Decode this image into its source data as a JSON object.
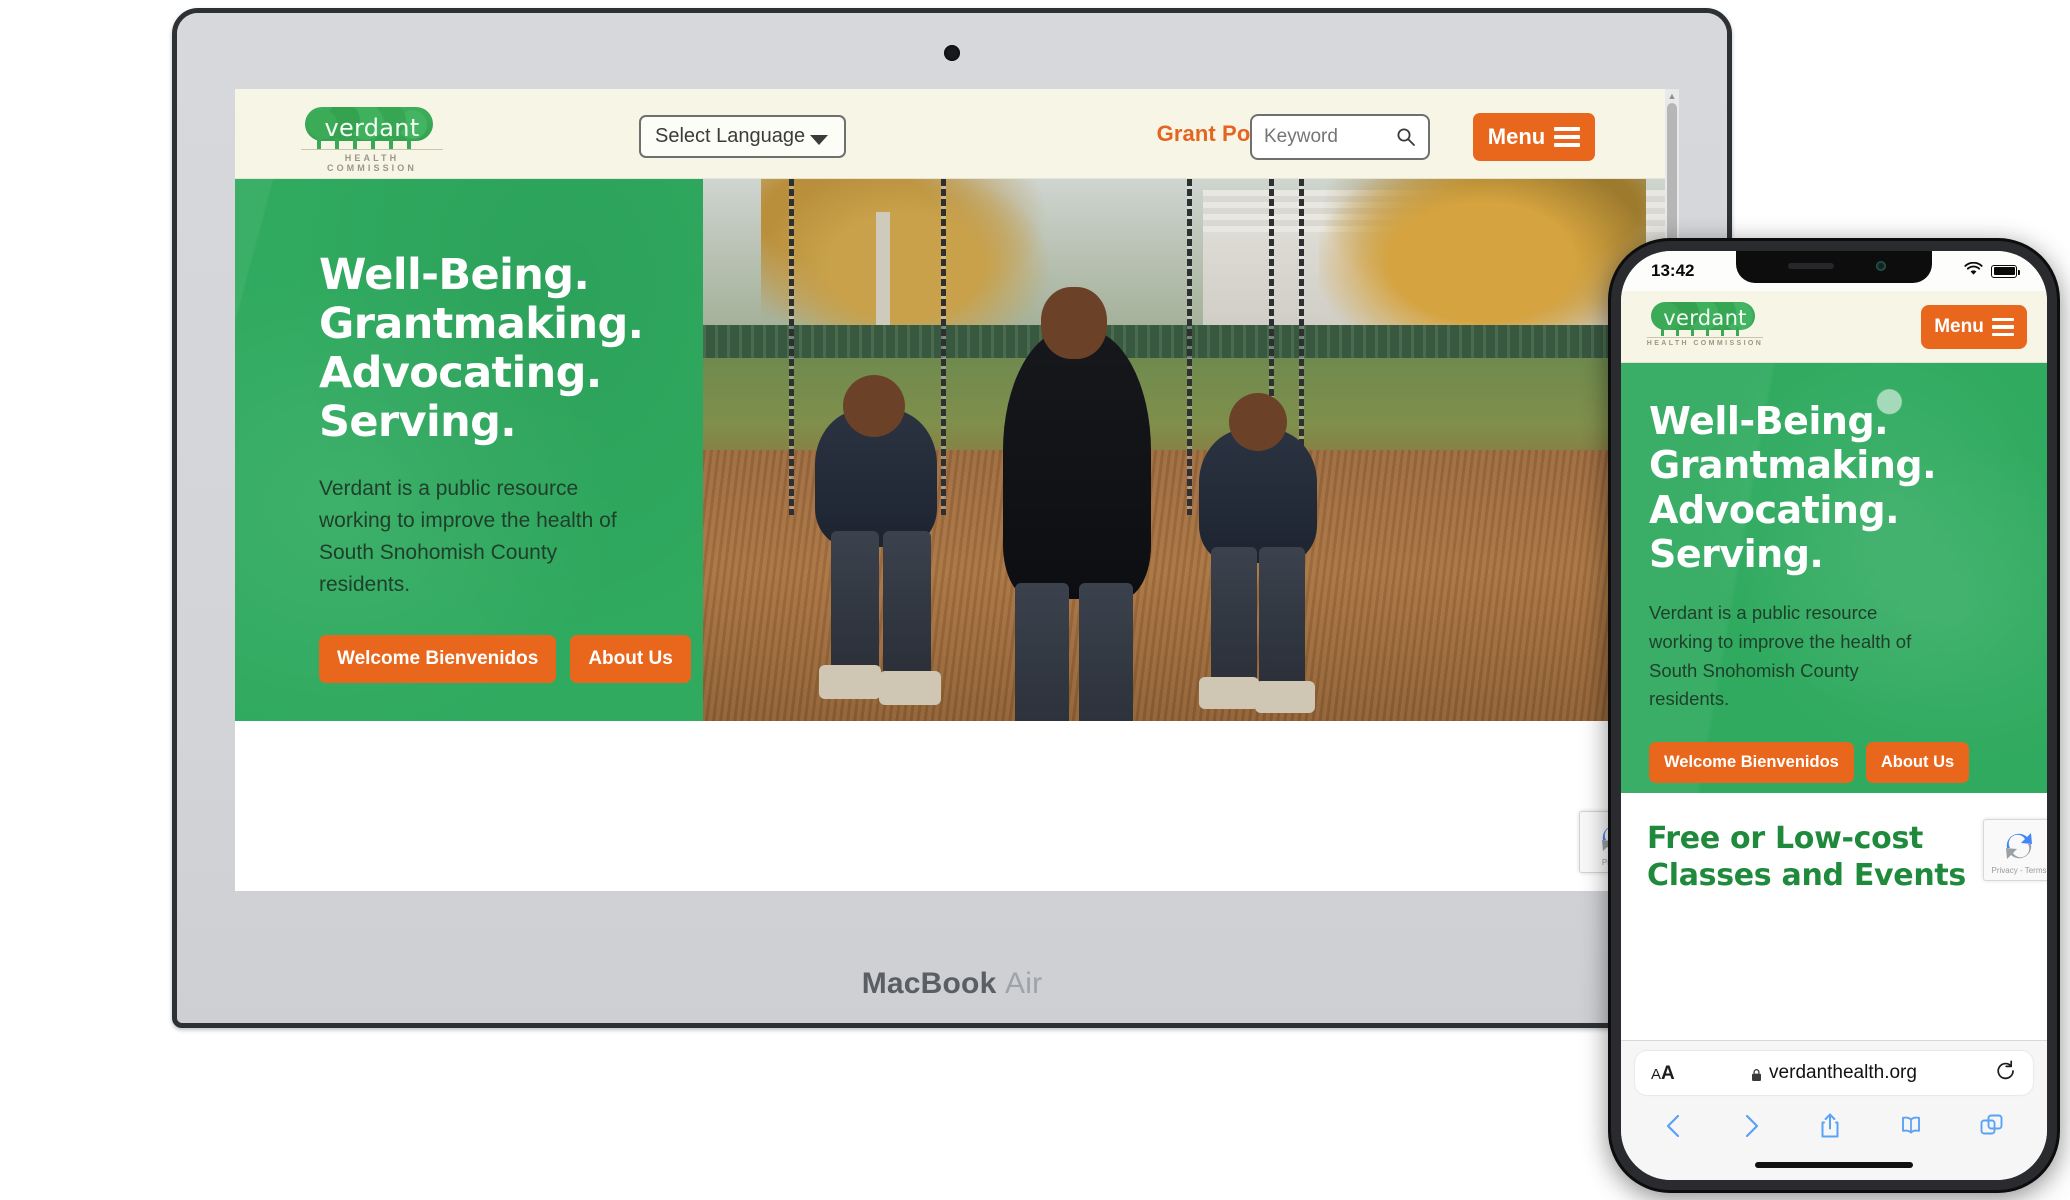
{
  "site": {
    "logo": {
      "word": "verdant",
      "tagline": "HEALTH COMMISSION"
    },
    "header": {
      "language_select": "Select Language",
      "grant_portal": "Grant Portal",
      "search_placeholder": "Keyword",
      "search_value": "",
      "menu_label": "Menu"
    },
    "hero": {
      "heading_lines": [
        "Well-Being.",
        "Grantmaking.",
        "Advocating.",
        "Serving."
      ],
      "paragraph": "Verdant is a public resource working to improve the health of South Snohomish County residents.",
      "buttons": [
        {
          "label": "Welcome Bienvenidos"
        },
        {
          "label": "About Us"
        }
      ]
    },
    "section": {
      "heading": "Free or Low-cost Classes and Events"
    },
    "recaptcha": {
      "privacy_label": "Privacy - Terms",
      "privacy_short": "Privacy"
    }
  },
  "laptop": {
    "brand_bold": "MacBook",
    "brand_light": "Air"
  },
  "phone": {
    "status": {
      "time": "13:42"
    },
    "safari": {
      "aa_small": "A",
      "aa_large": "A",
      "url": "verdanthealth.org"
    }
  },
  "colors": {
    "brand_green": "#2faa5f",
    "heading_green": "#1f8a3c",
    "accent_orange": "#e8671c",
    "grant_orange": "#e4651f",
    "header_cream": "#f7f5e6",
    "safari_blue": "#5aa2f5"
  }
}
